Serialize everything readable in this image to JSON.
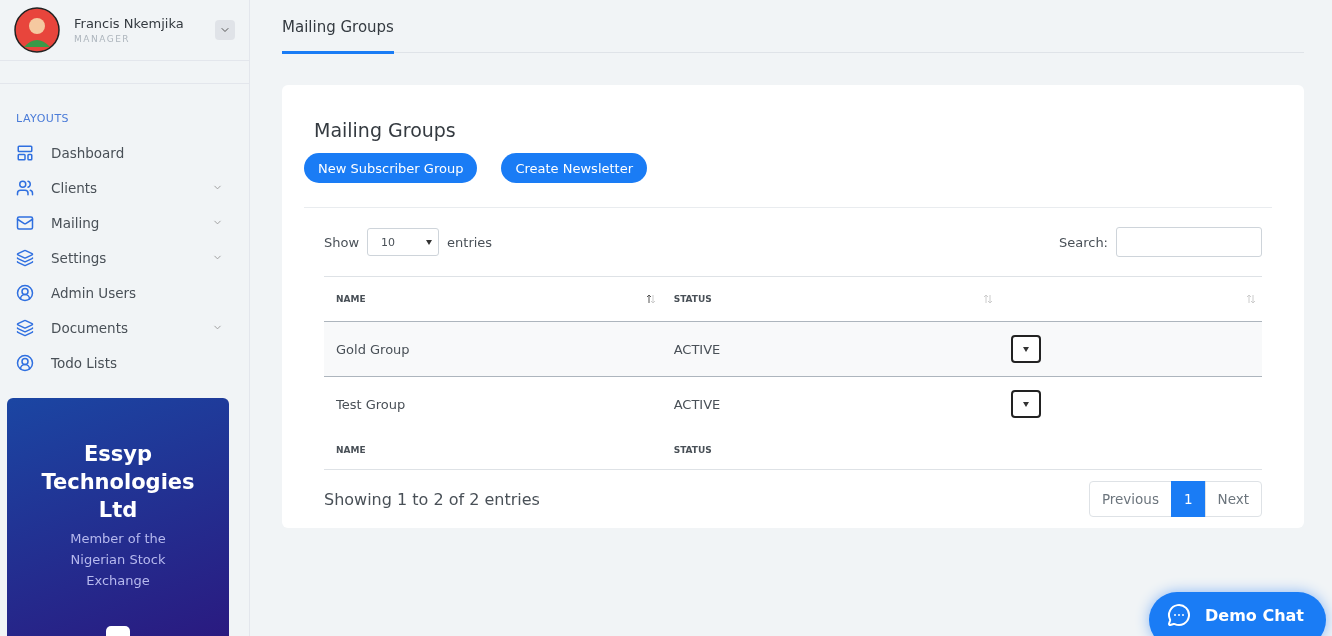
{
  "user": {
    "name": "Francis Nkemjika",
    "role": "MANAGER"
  },
  "sidebar": {
    "heading": "LAYOUTS",
    "items": [
      {
        "label": "Dashboard",
        "expandable": false
      },
      {
        "label": "Clients",
        "expandable": true
      },
      {
        "label": "Mailing",
        "expandable": true
      },
      {
        "label": "Settings",
        "expandable": true
      },
      {
        "label": "Admin Users",
        "expandable": false
      },
      {
        "label": "Documents",
        "expandable": true
      },
      {
        "label": "Todo Lists",
        "expandable": false
      }
    ]
  },
  "promo": {
    "title": "Essyp Technologies Ltd",
    "subtitle": "Member of the Nigerian Stock Exchange"
  },
  "page_tab": "Mailing Groups",
  "card": {
    "title": "Mailing Groups",
    "buttons": [
      "New Subscriber Group",
      "Create Newsletter"
    ],
    "length": {
      "before": "Show",
      "value": "10",
      "after": "entries"
    },
    "search_label": "Search:",
    "columns": [
      {
        "label": "NAME",
        "sorted": true
      },
      {
        "label": "STATUS",
        "sorted": false
      },
      {
        "sorted": false
      }
    ],
    "rows": [
      {
        "name": "Gold Group",
        "status": "ACTIVE"
      },
      {
        "name": "Test Group",
        "status": "ACTIVE"
      }
    ],
    "footer_columns": [
      "NAME",
      "STATUS"
    ],
    "info": "Showing 1 to 2 of 2 entries",
    "pagination": [
      {
        "label": "Previous",
        "selected": false
      },
      {
        "label": "1",
        "selected": true
      },
      {
        "label": "Next",
        "selected": false
      }
    ]
  },
  "chat": {
    "label": "Demo Chat"
  }
}
